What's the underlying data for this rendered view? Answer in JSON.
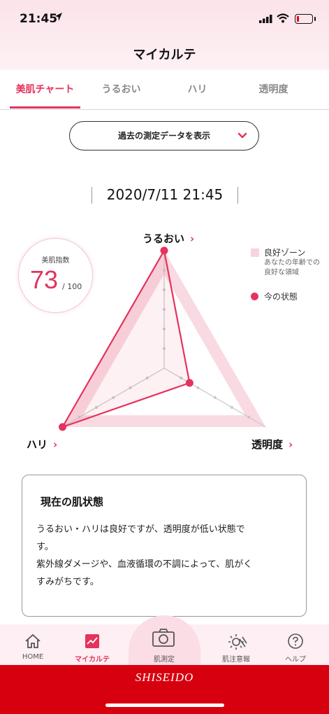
{
  "status_bar": {
    "time": "21:45",
    "icons": [
      "location-arrow-icon",
      "signal-icon",
      "wifi-icon",
      "battery-icon"
    ],
    "battery_level": 0.1
  },
  "header": {
    "title": "マイカルテ"
  },
  "tabs": [
    {
      "label": "美肌チャート",
      "active": true
    },
    {
      "label": "うるおい",
      "active": false
    },
    {
      "label": "ハリ",
      "active": false
    },
    {
      "label": "透明度",
      "active": false
    }
  ],
  "history_button": {
    "label": "過去の測定データを表示",
    "icon": "chevron-down-icon"
  },
  "measurement_date": "2020/7/11 21:45",
  "score": {
    "label": "美肌指数",
    "value": "73",
    "max": "/ 100"
  },
  "chart_data": {
    "type": "radar",
    "axes": [
      "うるおい",
      "透明度",
      "ハリ"
    ],
    "max": 100,
    "grid_levels": 5,
    "good_zone": {
      "label": "良好ゾーン",
      "description": "あなたの年齢での良好な領域",
      "outer": [
        100,
        100,
        100
      ],
      "inner": [
        80,
        80,
        80
      ]
    },
    "current": {
      "label": "今の状態",
      "values": [
        100,
        25,
        100
      ]
    }
  },
  "colors": {
    "accent": "#e4335c",
    "good_zone": "#f8d3dd",
    "brand_red": "#d7000f",
    "nav_bg": "#fdeff3"
  },
  "condition_card": {
    "title": "現在の肌状態",
    "lines": [
      "うるおい・ハリは良好ですが、透明度が低い状態で",
      "す。",
      "紫外線ダメージや、血液循環の不調によって、肌がく",
      "すみがちです。"
    ]
  },
  "bottom_nav": [
    {
      "label": "HOME",
      "icon": "home-icon",
      "active": false
    },
    {
      "label": "マイカルテ",
      "icon": "chart-icon",
      "active": true
    },
    {
      "label": "肌測定",
      "icon": "camera-icon",
      "active": false
    },
    {
      "label": "肌注意報",
      "icon": "sun-alert-icon",
      "active": false
    },
    {
      "label": "ヘルプ",
      "icon": "help-icon",
      "active": false
    }
  ],
  "brand": {
    "logo_text": "SHISEIDO"
  }
}
